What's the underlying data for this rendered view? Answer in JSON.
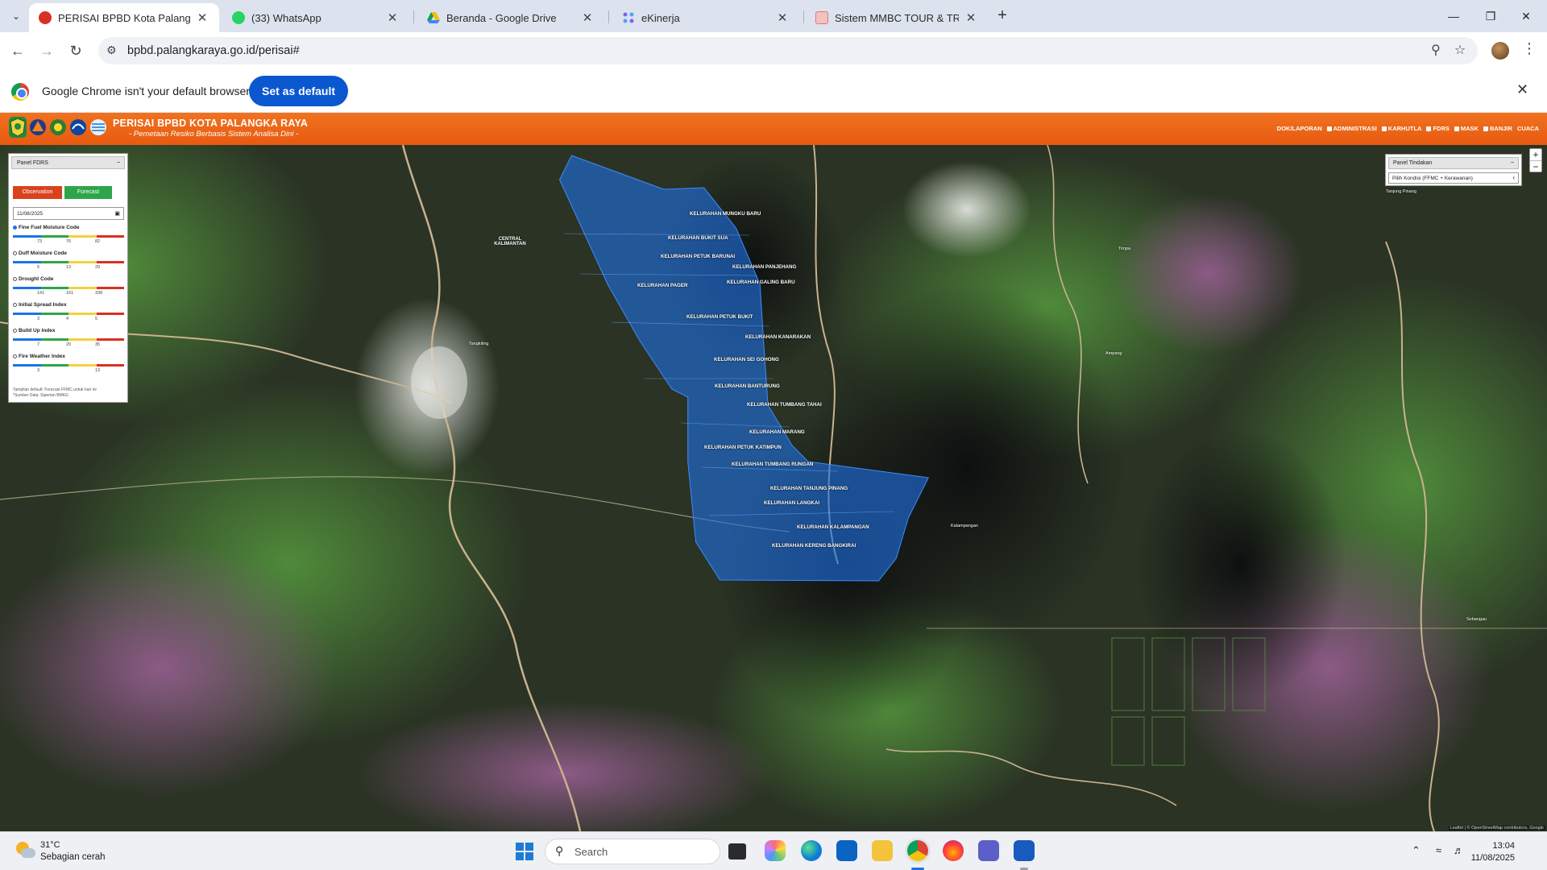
{
  "browser": {
    "tabs": [
      {
        "title": "PERISAI BPBD Kota Palangka Ra",
        "active": true,
        "favicon_color": "#d93025"
      },
      {
        "title": "(33) WhatsApp",
        "active": false,
        "favicon_color": "#25d366"
      },
      {
        "title": "Beranda - Google Drive",
        "active": false,
        "favicon_color": "#fbbc04"
      },
      {
        "title": "eKinerja",
        "active": false,
        "favicon_color": "#7b61ff"
      },
      {
        "title": "Sistem MMBC TOUR & TRAVEL",
        "active": false,
        "favicon_color": "#e57373"
      }
    ],
    "url": "bpbd.palangkaraya.go.id/perisai#",
    "infobar": {
      "message": "Google Chrome isn't your default browser",
      "button": "Set as default"
    }
  },
  "site": {
    "title": "PERISAI BPBD KOTA PALANGKA RAYA",
    "subtitle": "- Pemetaan Resiko Berbasis Sistem Analisa Dini -",
    "nav": [
      {
        "label": "DOK/LAPORAN",
        "checkbox": false
      },
      {
        "label": "ADMINISTRASI",
        "checkbox": true
      },
      {
        "label": "KARHUTLA",
        "checkbox": true
      },
      {
        "label": "FDRS",
        "checkbox": true
      },
      {
        "label": "MASK",
        "checkbox": true
      },
      {
        "label": "BANJIR",
        "checkbox": true
      },
      {
        "label": "CUACA",
        "checkbox": false
      }
    ],
    "brand_color": "#ec6418"
  },
  "fdrs_panel": {
    "title": "Panel FDRS",
    "btn_observation": "Observation",
    "btn_forecast": "Forecast",
    "date": "11/08/2025",
    "indices": [
      {
        "name": "Fine Fuel Moisture Code",
        "selected": true,
        "ticks": [
          "73",
          "76",
          "82"
        ]
      },
      {
        "name": "Duff Moisture Code",
        "selected": false,
        "ticks": [
          "5",
          "13",
          "29"
        ]
      },
      {
        "name": "Drought Code",
        "selected": false,
        "ticks": [
          "141",
          "161",
          "338"
        ]
      },
      {
        "name": "Initial Spread Index",
        "selected": false,
        "ticks": [
          "3",
          "4",
          "5"
        ]
      },
      {
        "name": "Build Up Index",
        "selected": false,
        "ticks": [
          "7",
          "20",
          "35"
        ]
      },
      {
        "name": "Fire Weather Index",
        "selected": false,
        "ticks": [
          "3",
          "",
          "13"
        ]
      }
    ],
    "note_line1": "Tampilan default: Forecast FFMC untuk hari ini",
    "note_line2": "*Sumber Data: Sipertan BMKG"
  },
  "tindakan_panel": {
    "title": "Panel Tindakan",
    "select_value": "Pilih Kondisi (FFMC + Kerawanan)"
  },
  "map": {
    "polygon_color": "#1f6fe0",
    "kelurahan": [
      "KELURAHAN MUNGKU BARU",
      "KELURAHAN BUKIT SUA",
      "KELURAHAN PETUK BARUNAI",
      "KELURAHAN PANJEHANG",
      "KELURAHAN PAGER",
      "KELURAHAN GALING BARU",
      "KELURAHAN PETUK BUKIT",
      "KELURAHAN KANARAKAN",
      "KELURAHAN SEI GOHONG",
      "KELURAHAN BANTURUNG",
      "KELURAHAN TUMBANG TAHAI",
      "KELURAHAN MARANG",
      "KELURAHAN PETUK KATIMPUN",
      "KELURAHAN TUMBANG RUNGAN",
      "KELURAHAN TANJUNG PINANG",
      "KELURAHAN LANGKAI",
      "KELURAHAN KALAMPANGAN",
      "KELURAHAN KERENG BANGKIRAI"
    ],
    "places": [
      "CENTRAL KALIMANTAN",
      "Tangkiling",
      "Timpa",
      "Ampang",
      "Tanjung Pinang",
      "Kalampangan",
      "Sebangau"
    ],
    "attribution": "Leaflet | © OpenStreetMap contributors, Google"
  },
  "taskbar": {
    "temperature": "31°C",
    "weather": "Sebagian cerah",
    "search_placeholder": "Search",
    "time": "13:04",
    "date": "11/08/2025"
  }
}
